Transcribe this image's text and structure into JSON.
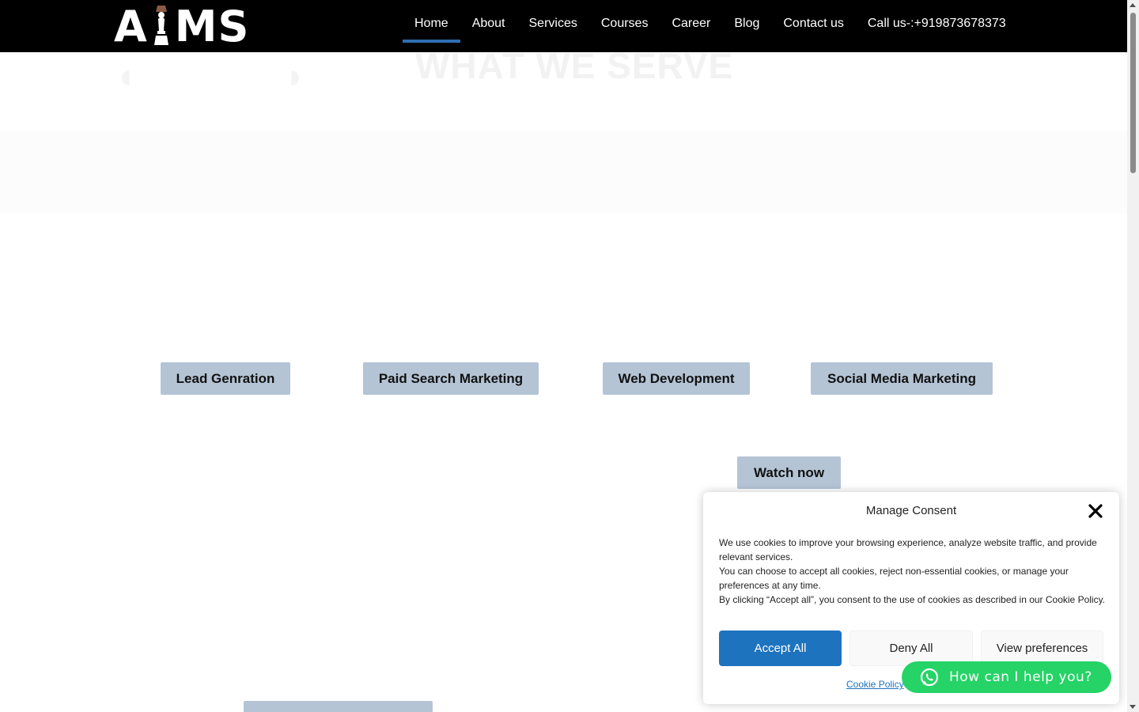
{
  "header": {
    "logo_left": "A",
    "logo_right": "MS",
    "nav": [
      {
        "label": "Home",
        "active": true
      },
      {
        "label": "About",
        "active": false
      },
      {
        "label": "Services",
        "active": false
      },
      {
        "label": "Courses",
        "active": false
      },
      {
        "label": "Career",
        "active": false
      },
      {
        "label": "Blog",
        "active": false
      },
      {
        "label": "Contact us",
        "active": false
      },
      {
        "label": "Call us-:+919873678373",
        "active": false
      }
    ],
    "accent_color": "#2f6fb3"
  },
  "hero": {
    "title": "WHAT WE SERVE"
  },
  "services": {
    "buttons": [
      "Lead Genration",
      "Paid Search Marketing",
      "Web Development",
      "Social Media Marketing"
    ],
    "watch_label": "Watch now",
    "button_color": "#b4c4d5"
  },
  "consent": {
    "title": "Manage Consent",
    "paragraphs": [
      "We use cookies to improve your browsing experience, analyze website traffic, and provide relevant services.",
      "You can choose to accept all cookies, reject non-essential cookies, or manage your preferences at any time.",
      "By clicking “Accept all”, you consent to the use of cookies as described in our Cookie Policy."
    ],
    "accept_label": "Accept All",
    "deny_label": "Deny All",
    "prefs_label": "View preferences",
    "policy_link": "Cookie Policy",
    "accept_color": "#1e73be"
  },
  "whatsapp": {
    "label": "How can I help you?",
    "color": "#25d366",
    "icon": "whatsapp-icon"
  }
}
